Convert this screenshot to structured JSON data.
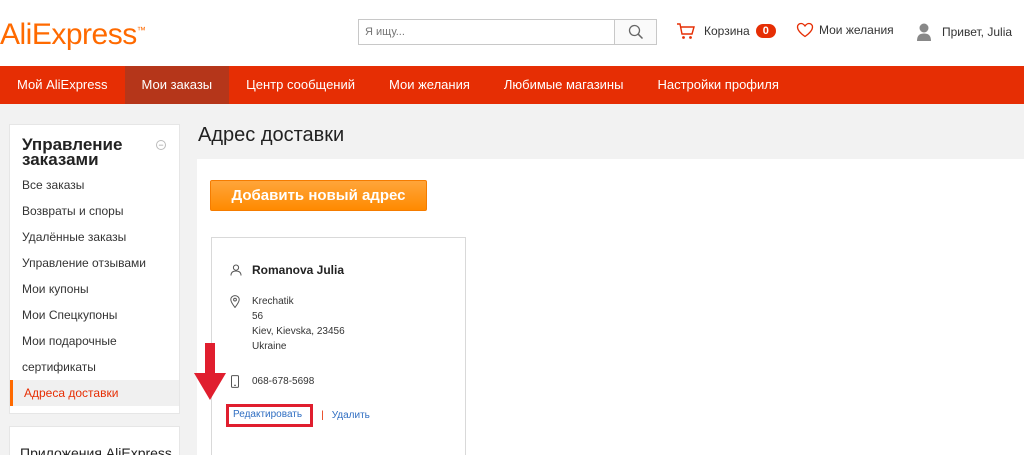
{
  "header": {
    "logo": "AliExpress",
    "logo_tm": "™",
    "search_placeholder": "Я ищу...",
    "cart_label": "Корзина",
    "cart_count": "0",
    "wishlist_label": "Мои желания",
    "greeting": "Привет, Julia"
  },
  "nav": {
    "items": [
      "Мой AliExpress",
      "Мои заказы",
      "Центр сообщений",
      "Мои желания",
      "Любимые магазины",
      "Настройки профиля"
    ]
  },
  "sidebar": {
    "title": "Управление заказами",
    "collapse_symbol": "−",
    "items": [
      "Все заказы",
      "Возвраты и споры",
      "Удалённые заказы",
      "Управление отзывами",
      "Мои купоны",
      "Мои Спецкупоны",
      "Мои подарочные",
      "сертификаты",
      "Адреса доставки"
    ],
    "apps_title": "Приложения AliExpress"
  },
  "main": {
    "page_title": "Адрес доставки",
    "add_button": "Добавить новый адрес",
    "card": {
      "name": "Romanova Julia",
      "address_lines": [
        "Krechatik",
        "56",
        "Kiev, Kievska, 23456",
        "Ukraine"
      ],
      "phone": "068-678-5698",
      "edit_label": "Редактировать",
      "separator": "|",
      "delete_label": "Удалить"
    }
  },
  "colors": {
    "brand_orange": "#ff6a00",
    "nav_red": "#e62e04",
    "nav_active": "#b5361a",
    "annotation_red": "#e01e2e",
    "link_blue": "#2f6ec2"
  }
}
